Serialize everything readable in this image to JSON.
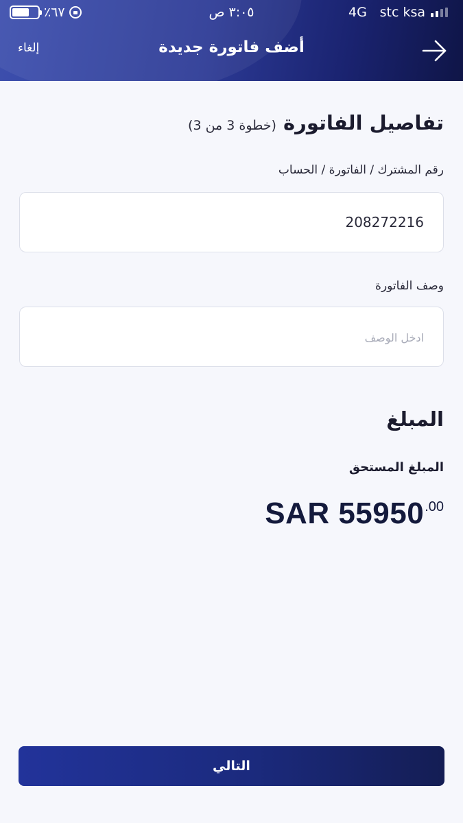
{
  "status_bar": {
    "battery": "٪٦٧",
    "time": "٣:٠٥ ص",
    "network": "4G",
    "carrier": "stc ksa"
  },
  "nav": {
    "title": "أضف فاتورة جديدة",
    "cancel_label": "إلغاء"
  },
  "form": {
    "title": "تفاصيل الفاتورة",
    "step": "(خطوة 3 من 3)",
    "account_label": "رقم المشترك / الفاتورة / الحساب",
    "account_value": "208272216",
    "description_label": "وصف الفاتورة",
    "description_placeholder": "ادخل الوصف"
  },
  "amount": {
    "title": "المبلغ",
    "due_label": "المبلغ المستحق",
    "currency_value": "SAR 55950",
    "decimal": ".00"
  },
  "actions": {
    "next_label": "التالي"
  },
  "colors": {
    "header_start": "#3d4fae",
    "header_end": "#0f1547",
    "button": "#1b2a7d",
    "background": "#f6f7fc"
  }
}
